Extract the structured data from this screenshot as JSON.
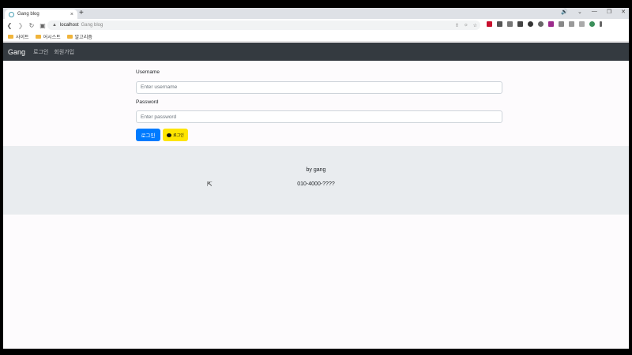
{
  "browser": {
    "tab_title": "Gang blog",
    "tab_close": "×",
    "new_tab": "+",
    "window_controls": [
      "🔊",
      "⌄",
      "—",
      "❐",
      "✕"
    ],
    "url_host": "localhost",
    "url_title": "Gang blog",
    "bookmarks": [
      "사이트",
      "어시스트",
      "알고리즘"
    ]
  },
  "navbar": {
    "brand": "Gang",
    "links": [
      "로그인",
      "회원가입"
    ]
  },
  "form": {
    "username_label": "Username",
    "username_placeholder": "Enter username",
    "password_label": "Password",
    "password_placeholder": "Enter password",
    "login_button": "로그인",
    "kakao_button": "로그인"
  },
  "footer": {
    "author": "by gang",
    "phone": "010-4000-????"
  },
  "colors": {
    "navbar": "#343a40",
    "primary": "#007bff",
    "kakao": "#fee500",
    "footer": "#e9ecef"
  }
}
